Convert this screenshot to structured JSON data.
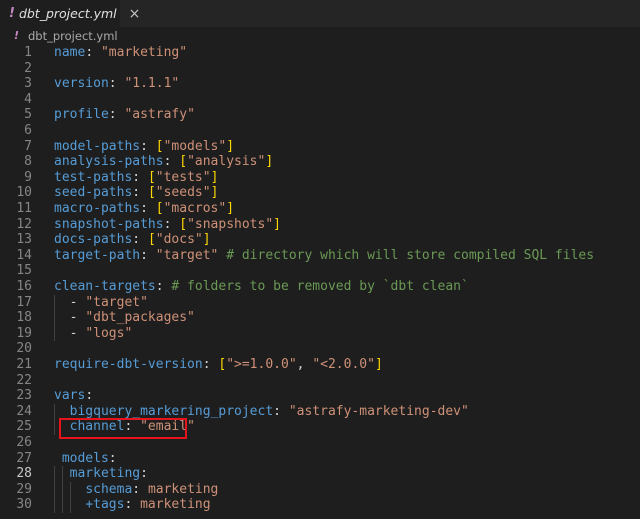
{
  "tab": {
    "label": "dbt_project.yml",
    "icon": "yaml-file-icon",
    "close": "×"
  },
  "breadcrumb": {
    "file": "dbt_project.yml",
    "icon": "yaml-file-icon"
  },
  "colors": {
    "key": "#569cd6",
    "string": "#ce9178",
    "bracket": "#ffd700",
    "comment": "#6a9955",
    "highlight": "#e8141b"
  },
  "active_line": 28,
  "highlighted_line": 25,
  "lines": [
    {
      "n": "1",
      "tokens": [
        [
          "k",
          "name"
        ],
        [
          "p",
          ": "
        ],
        [
          "s",
          "\"marketing\""
        ]
      ]
    },
    {
      "n": "2",
      "tokens": []
    },
    {
      "n": "3",
      "tokens": [
        [
          "k",
          "version"
        ],
        [
          "p",
          ": "
        ],
        [
          "s",
          "\"1.1.1\""
        ]
      ]
    },
    {
      "n": "4",
      "tokens": []
    },
    {
      "n": "5",
      "tokens": [
        [
          "k",
          "profile"
        ],
        [
          "p",
          ": "
        ],
        [
          "s",
          "\"astrafy\""
        ]
      ]
    },
    {
      "n": "6",
      "tokens": []
    },
    {
      "n": "7",
      "tokens": [
        [
          "k",
          "model-paths"
        ],
        [
          "p",
          ": "
        ],
        [
          "b",
          "["
        ],
        [
          "s",
          "\"models\""
        ],
        [
          "b",
          "]"
        ]
      ]
    },
    {
      "n": "8",
      "tokens": [
        [
          "k",
          "analysis-paths"
        ],
        [
          "p",
          ": "
        ],
        [
          "b",
          "["
        ],
        [
          "s",
          "\"analysis\""
        ],
        [
          "b",
          "]"
        ]
      ]
    },
    {
      "n": "9",
      "tokens": [
        [
          "k",
          "test-paths"
        ],
        [
          "p",
          ": "
        ],
        [
          "b",
          "["
        ],
        [
          "s",
          "\"tests\""
        ],
        [
          "b",
          "]"
        ]
      ]
    },
    {
      "n": "10",
      "tokens": [
        [
          "k",
          "seed-paths"
        ],
        [
          "p",
          ": "
        ],
        [
          "b",
          "["
        ],
        [
          "s",
          "\"seeds\""
        ],
        [
          "b",
          "]"
        ]
      ]
    },
    {
      "n": "11",
      "tokens": [
        [
          "k",
          "macro-paths"
        ],
        [
          "p",
          ": "
        ],
        [
          "b",
          "["
        ],
        [
          "s",
          "\"macros\""
        ],
        [
          "b",
          "]"
        ]
      ]
    },
    {
      "n": "12",
      "tokens": [
        [
          "k",
          "snapshot-paths"
        ],
        [
          "p",
          ": "
        ],
        [
          "b",
          "["
        ],
        [
          "s",
          "\"snapshots\""
        ],
        [
          "b",
          "]"
        ]
      ]
    },
    {
      "n": "13",
      "tokens": [
        [
          "k",
          "docs-paths"
        ],
        [
          "p",
          ": "
        ],
        [
          "b",
          "["
        ],
        [
          "s",
          "\"docs\""
        ],
        [
          "b",
          "]"
        ]
      ]
    },
    {
      "n": "14",
      "tokens": [
        [
          "k",
          "target-path"
        ],
        [
          "p",
          ": "
        ],
        [
          "s",
          "\"target\""
        ],
        [
          "p",
          " "
        ],
        [
          "c",
          "# directory which will store compiled SQL files"
        ]
      ]
    },
    {
      "n": "15",
      "tokens": []
    },
    {
      "n": "16",
      "tokens": [
        [
          "k",
          "clean-targets"
        ],
        [
          "p",
          ": "
        ],
        [
          "c",
          "# folders to be removed by `dbt clean`"
        ]
      ]
    },
    {
      "n": "17",
      "tokens": [
        [
          "p",
          "  - "
        ],
        [
          "s",
          "\"target\""
        ]
      ]
    },
    {
      "n": "18",
      "tokens": [
        [
          "p",
          "  - "
        ],
        [
          "s",
          "\"dbt_packages\""
        ]
      ]
    },
    {
      "n": "19",
      "tokens": [
        [
          "p",
          "  - "
        ],
        [
          "s",
          "\"logs\""
        ]
      ]
    },
    {
      "n": "20",
      "tokens": []
    },
    {
      "n": "21",
      "tokens": [
        [
          "k",
          "require-dbt-version"
        ],
        [
          "p",
          ": "
        ],
        [
          "b",
          "["
        ],
        [
          "s",
          "\">=1.0.0\""
        ],
        [
          "p",
          ", "
        ],
        [
          "s",
          "\"<2.0.0\""
        ],
        [
          "b",
          "]"
        ]
      ]
    },
    {
      "n": "22",
      "tokens": []
    },
    {
      "n": "23",
      "tokens": [
        [
          "k",
          "vars"
        ],
        [
          "p",
          ":"
        ]
      ]
    },
    {
      "n": "24",
      "tokens": [
        [
          "p",
          "  "
        ],
        [
          "k",
          "bigquery_markering_project"
        ],
        [
          "p",
          ": "
        ],
        [
          "s",
          "\"astrafy-marketing-dev\""
        ]
      ]
    },
    {
      "n": "25",
      "tokens": [
        [
          "p",
          "  "
        ],
        [
          "k",
          "channel"
        ],
        [
          "p",
          ": "
        ],
        [
          "s",
          "\"email\""
        ]
      ]
    },
    {
      "n": "26",
      "tokens": []
    },
    {
      "n": "27",
      "tokens": [
        [
          "p",
          " "
        ],
        [
          "k",
          "models"
        ],
        [
          "p",
          ":"
        ]
      ]
    },
    {
      "n": "28",
      "tokens": [
        [
          "p",
          "  "
        ],
        [
          "k",
          "marketing"
        ],
        [
          "p",
          ":"
        ]
      ]
    },
    {
      "n": "29",
      "tokens": [
        [
          "p",
          "    "
        ],
        [
          "k",
          "schema"
        ],
        [
          "p",
          ": "
        ],
        [
          "s",
          "marketing"
        ]
      ]
    },
    {
      "n": "30",
      "tokens": [
        [
          "p",
          "    "
        ],
        [
          "k",
          "+tags"
        ],
        [
          "p",
          ": "
        ],
        [
          "s",
          "marketing"
        ]
      ]
    }
  ]
}
